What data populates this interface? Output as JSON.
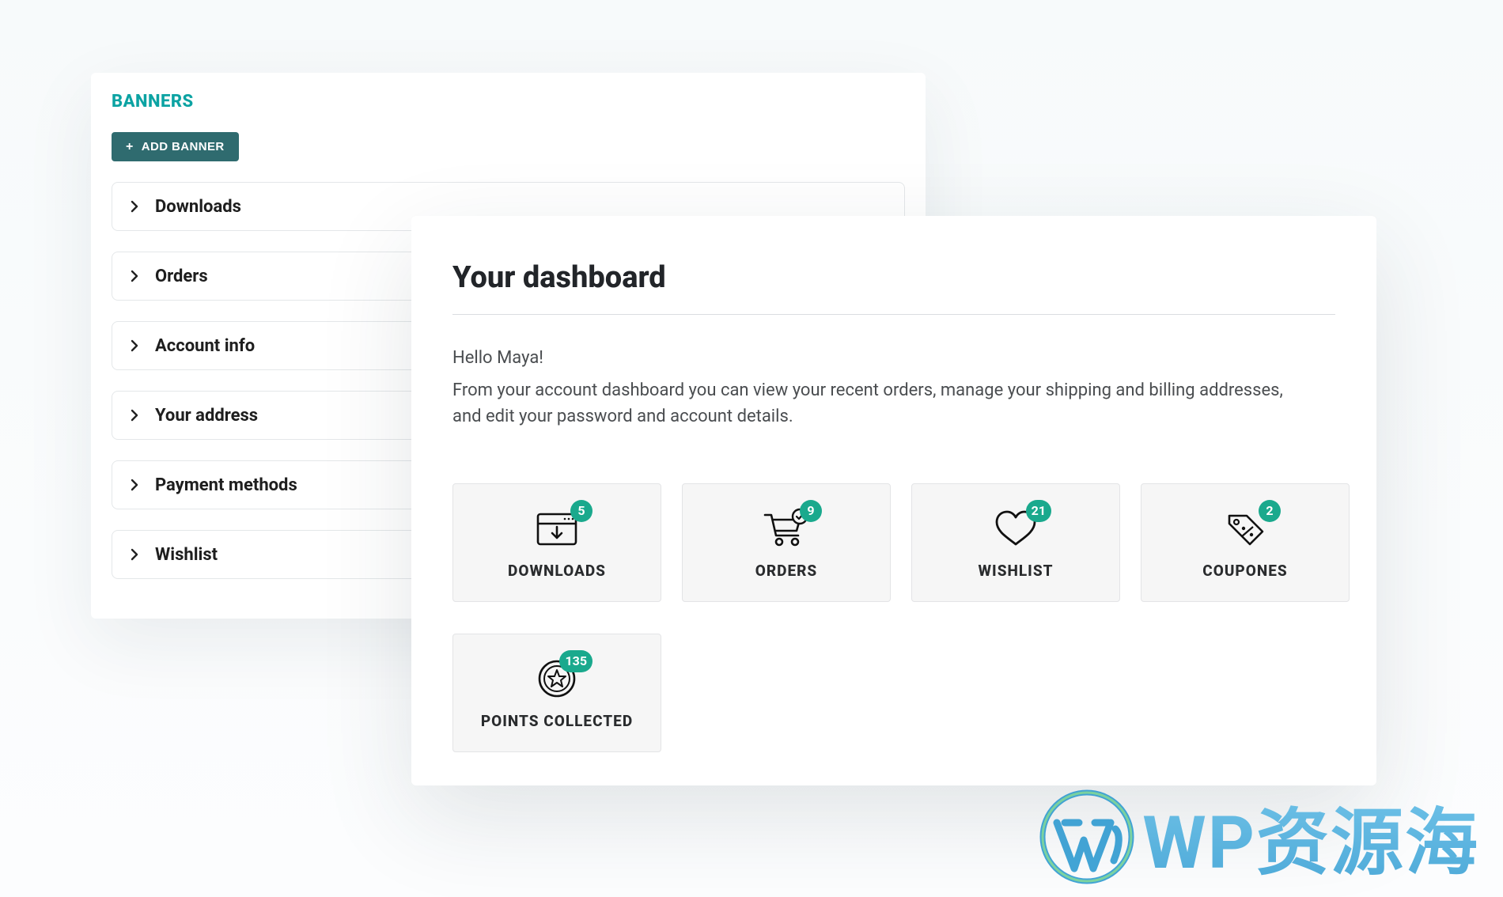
{
  "back_panel": {
    "title": "BANNERS",
    "add_button": "ADD BANNER",
    "items": [
      {
        "label": "Downloads"
      },
      {
        "label": "Orders"
      },
      {
        "label": "Account info"
      },
      {
        "label": "Your address"
      },
      {
        "label": "Payment methods"
      },
      {
        "label": "Wishlist"
      }
    ]
  },
  "dashboard": {
    "title": "Your dashboard",
    "greeting": "Hello Maya!",
    "intro": "From your account dashboard you can view your recent orders, manage your shipping and billing addresses, and edit your password and account details.",
    "cards": [
      {
        "key": "downloads",
        "label": "DOWNLOADS",
        "count": 5,
        "icon": "download-box-icon"
      },
      {
        "key": "orders",
        "label": "ORDERS",
        "count": 9,
        "icon": "cart-check-icon"
      },
      {
        "key": "wishlist",
        "label": "WISHLIST",
        "count": 21,
        "icon": "heart-icon"
      },
      {
        "key": "coupones",
        "label": "COUPONES",
        "count": 2,
        "icon": "tag-percent-icon"
      },
      {
        "key": "points",
        "label": "POINTS COLLECTED",
        "count": 135,
        "icon": "star-badge-icon"
      }
    ]
  },
  "watermark": {
    "text": "WP资源海"
  },
  "colors": {
    "accent_teal": "#0ca3a3",
    "button_teal": "#2f6b6f",
    "badge_green": "#1aa98d"
  }
}
